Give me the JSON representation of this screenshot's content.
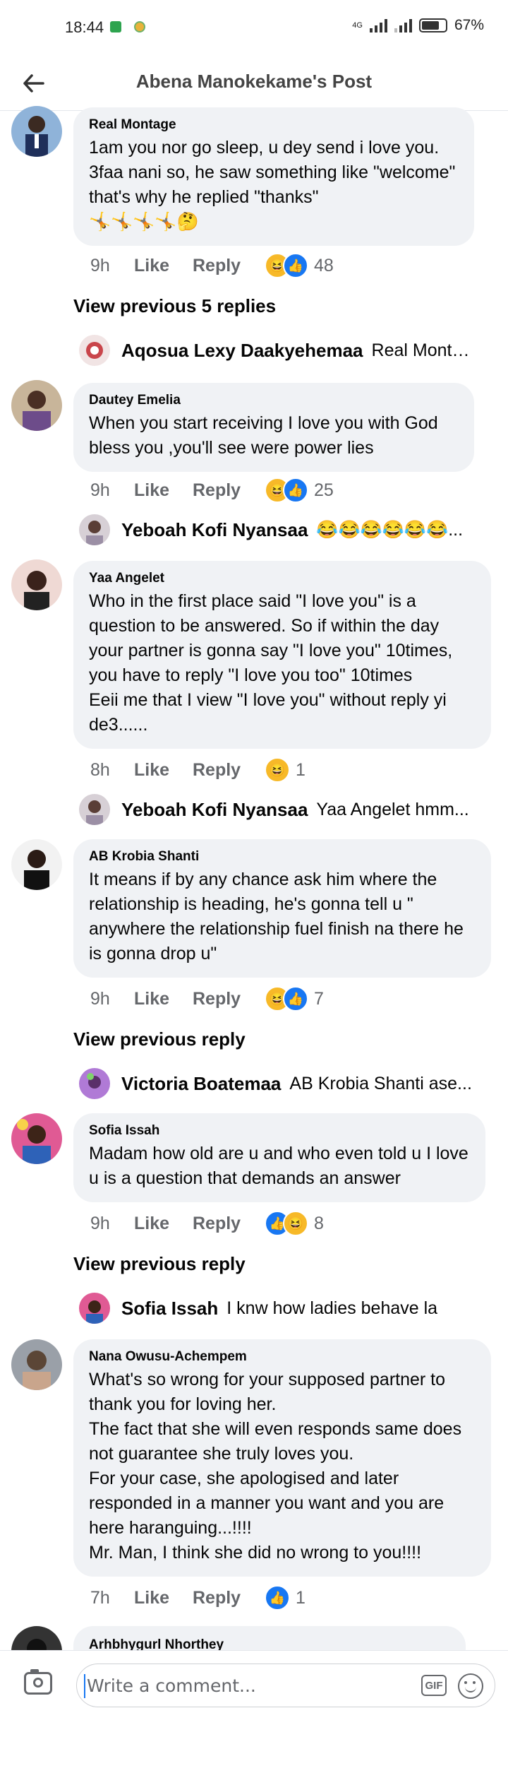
{
  "status_bar": {
    "time": "18:44",
    "network": "4G",
    "battery": "67%"
  },
  "header": {
    "title": "Abena Manokekame's Post",
    "back_icon": "arrow-left-icon"
  },
  "colors": {
    "accent": "#1877f2",
    "haha": "#f7b928",
    "bubble": "#f0f2f5",
    "meta": "#65676b"
  },
  "comments": [
    {
      "name": "Real Montage",
      "text": "1am you nor go sleep, u dey send i love you.\n3faa nani so, he saw something like \"welcome\"  that's why he replied \"thanks\"\n🤸🤸🤸🤸🤔",
      "time": "9h",
      "like": "Like",
      "reply": "Reply",
      "count": "48"
    },
    {
      "name": "Dautey Emelia",
      "text": "When you start receiving I love you with God bless you ,you'll see were power lies",
      "time": "9h",
      "like": "Like",
      "reply": "Reply",
      "count": "25"
    },
    {
      "name": "Yaa Angelet",
      "text": "Who in the first place said \"I love you\" is a question to be answered. So if within the day your partner is gonna say \"I love you\" 10times, you have to reply \"I love you too\" 10times\nEeii me that I view \"I love you\" without reply yi de3......",
      "time": "8h",
      "like": "Like",
      "reply": "Reply",
      "count": "1"
    },
    {
      "name": "AB Krobia Shanti",
      "text": "It means if  by any chance ask him where the relationship is heading, he's gonna tell u \" anywhere the relationship fuel  finish na there he is gonna drop u\"",
      "time": "9h",
      "like": "Like",
      "reply": "Reply",
      "count": "7"
    },
    {
      "name": "Sofia Issah",
      "text": "Madam how old are u and who even told u I love u is a question that demands an answer",
      "time": "9h",
      "like": "Like",
      "reply": "Reply",
      "count": "8"
    },
    {
      "name": "Nana Owusu-Achempem",
      "text": "What's so wrong for your supposed partner to thank you for loving her.\nThe fact that she will even responds same does not guarantee she truly loves you.\nFor your case, she apologised and later responded in a manner you want and you are here haranguing...!!!!\nMr. Man, I think she did no wrong to you!!!!",
      "time": "7h",
      "like": "Like",
      "reply": "Reply",
      "count": "1"
    },
    {
      "name": "Arhbhygurl Nhorthey"
    }
  ],
  "view_previous": {
    "five": "View previous 5 replies",
    "one": "View previous reply",
    "one_b": "View previous reply"
  },
  "replies": [
    {
      "name": "Aqosua Lexy Daakyehemaa",
      "text": "Real Monta..."
    },
    {
      "name": "Yeboah Kofi Nyansaa",
      "text": "😂😂😂😂😂😂..."
    },
    {
      "name": "Yeboah Kofi Nyansaa",
      "text": "Yaa Angelet hmm..."
    },
    {
      "name": "Victoria Boatemaa",
      "text": "AB Krobia Shanti ase..."
    },
    {
      "name": "Sofia Issah",
      "text": "I knw how ladies behave la"
    }
  ],
  "composer": {
    "placeholder": "Write a comment...",
    "gif": "GIF"
  }
}
